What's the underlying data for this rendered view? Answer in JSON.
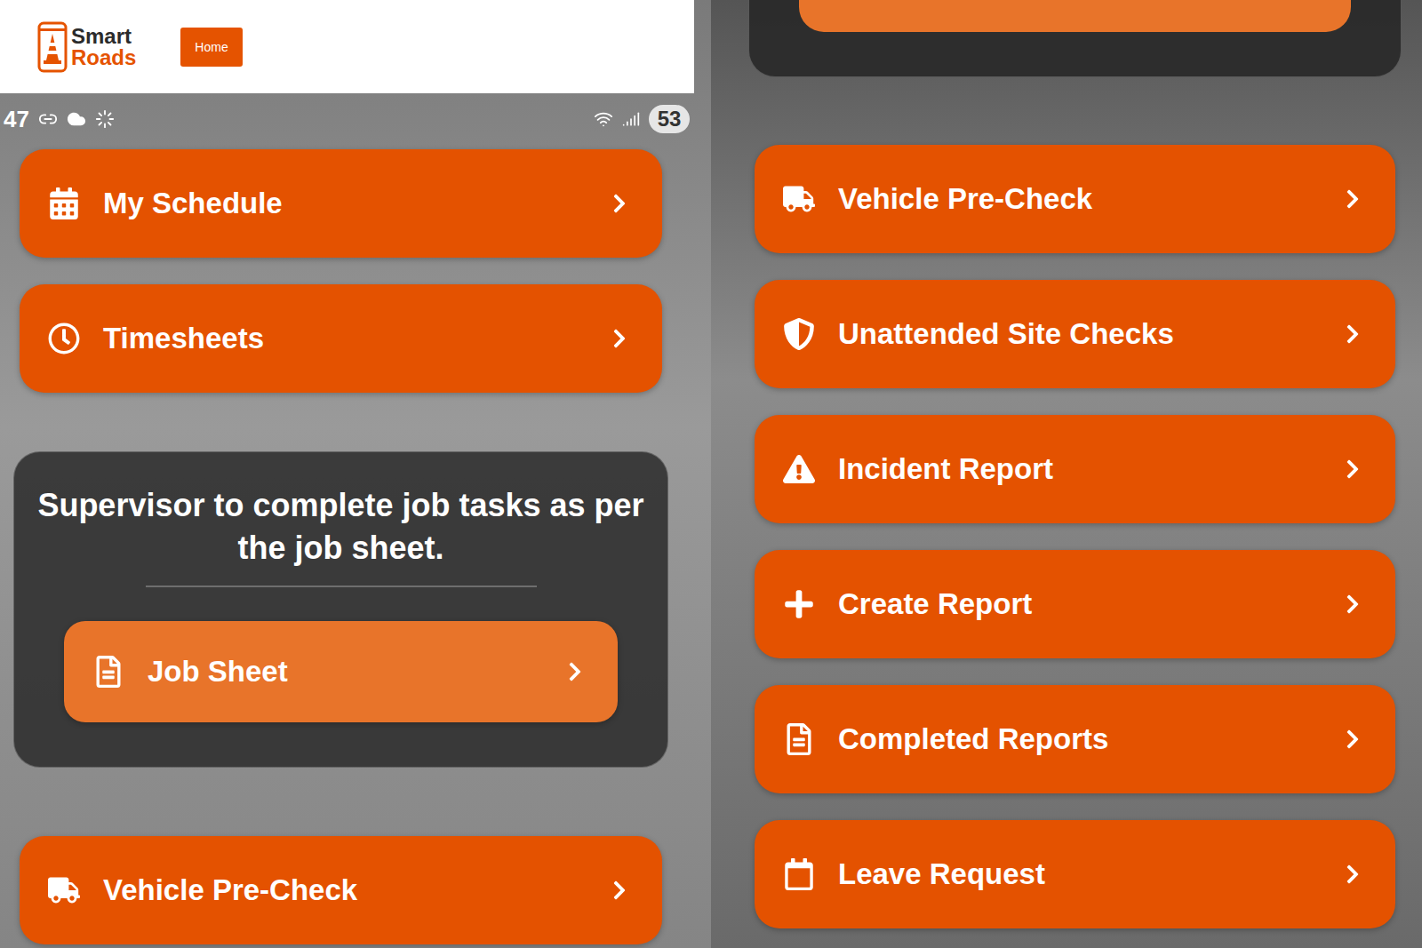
{
  "header": {
    "logo": {
      "line1": "Smart",
      "line2": "Roads"
    },
    "nav": [
      {
        "label": "Home",
        "selected": true
      }
    ]
  },
  "left_phone": {
    "status_bar": {
      "time": "47",
      "battery": "53"
    },
    "menu_top": [
      {
        "label": "My Schedule"
      },
      {
        "label": "Timesheets"
      }
    ],
    "notice": {
      "text": "Supervisor to complete job tasks as per the job sheet.",
      "button": "Job Sheet"
    },
    "menu_bottom": [
      {
        "label": "Vehicle Pre-Check"
      }
    ]
  },
  "right_phone": {
    "menu": [
      {
        "label": "Vehicle Pre-Check"
      },
      {
        "label": "Unattended Site Checks"
      },
      {
        "label": "Incident Report"
      },
      {
        "label": "Create Report"
      },
      {
        "label": "Completed Reports"
      },
      {
        "label": "Leave Request"
      }
    ]
  }
}
